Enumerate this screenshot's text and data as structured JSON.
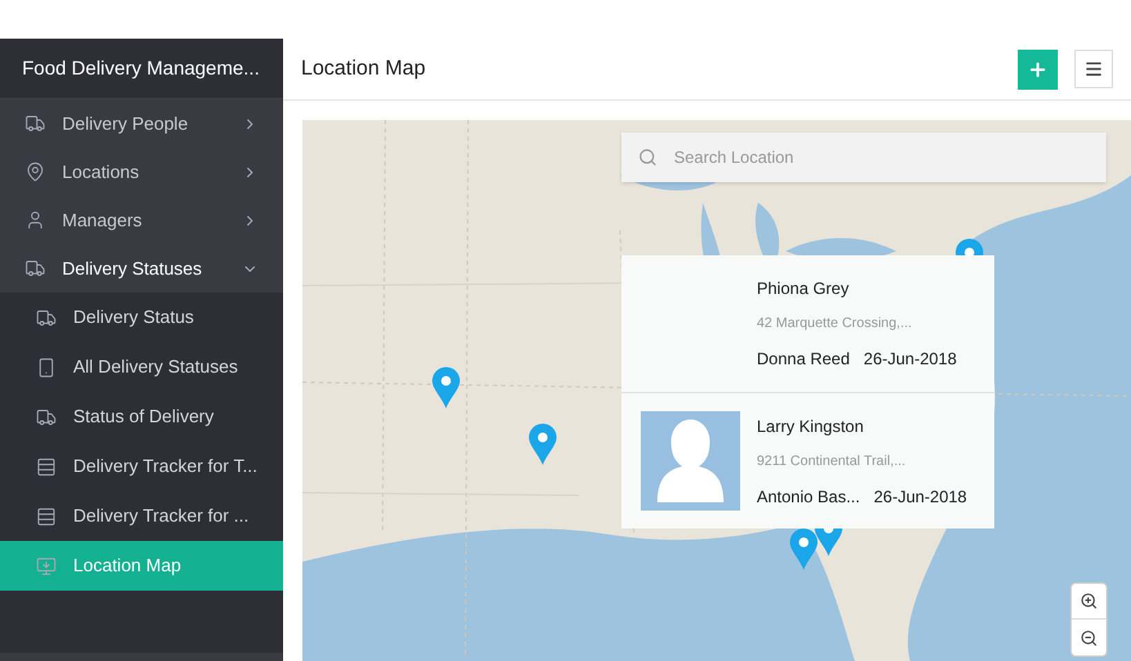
{
  "sidebar": {
    "title": "Food Delivery Manageme...",
    "items": [
      {
        "label": "Delivery People",
        "expanded": false
      },
      {
        "label": "Locations",
        "expanded": false
      },
      {
        "label": "Managers",
        "expanded": false
      },
      {
        "label": "Delivery Statuses",
        "expanded": true,
        "children": [
          {
            "label": "Delivery Status",
            "selected": false
          },
          {
            "label": "All Delivery Statuses",
            "selected": false
          },
          {
            "label": "Status of Delivery",
            "selected": false
          },
          {
            "label": "Delivery Tracker for T...",
            "selected": false
          },
          {
            "label": "Delivery Tracker for ...",
            "selected": false
          },
          {
            "label": "Location Map",
            "selected": true
          }
        ]
      }
    ]
  },
  "header": {
    "title": "Location Map"
  },
  "map": {
    "search": {
      "placeholder": "Search Location"
    },
    "popup": [
      {
        "name": "Phiona Grey",
        "address": "42 Marquette Crossing,...",
        "person": "Donna Reed",
        "date": "26-Jun-2018",
        "avatar": false
      },
      {
        "name": "Larry Kingston",
        "address": "9211 Continental Trail,...",
        "person": "Antonio Bas...",
        "date": "26-Jun-2018",
        "avatar": true
      }
    ]
  }
}
